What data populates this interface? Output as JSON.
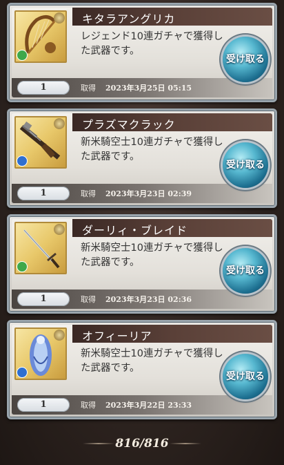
{
  "items": [
    {
      "name": "キタラアングリカ",
      "description": "レジェンド10連ガチャで獲得した武器です。",
      "quantity": "1",
      "acquired_label": "取得",
      "acquired_date": "2023年3月25日 05:15",
      "receive_label": "受け取る",
      "icon": "harp-weapon-icon",
      "element_color": "#3fa84a"
    },
    {
      "name": "プラズマクラック",
      "description": "新米騎空士10連ガチャで獲得した武器です。",
      "quantity": "1",
      "acquired_label": "取得",
      "acquired_date": "2023年3月23日 02:39",
      "receive_label": "受け取る",
      "icon": "gun-weapon-icon",
      "element_color": "#2f6fd0"
    },
    {
      "name": "ダーリィ・ブレイド",
      "description": "新米騎空士10連ガチャで獲得した武器です。",
      "quantity": "1",
      "acquired_label": "取得",
      "acquired_date": "2023年3月23日 02:36",
      "receive_label": "受け取る",
      "icon": "sword-weapon-icon",
      "element_color": "#3fa84a"
    },
    {
      "name": "オフィーリア",
      "description": "新米騎空士10連ガチャで獲得した武器です。",
      "quantity": "1",
      "acquired_label": "取得",
      "acquired_date": "2023年3月22日 23:33",
      "receive_label": "受け取る",
      "icon": "ice-statue-weapon-icon",
      "element_color": "#2f6fd0"
    }
  ],
  "counter": "816/816",
  "colors": {
    "button_blue": "#57b8d0",
    "name_bar": "#3a2824",
    "frame": "#9aa5ad"
  }
}
